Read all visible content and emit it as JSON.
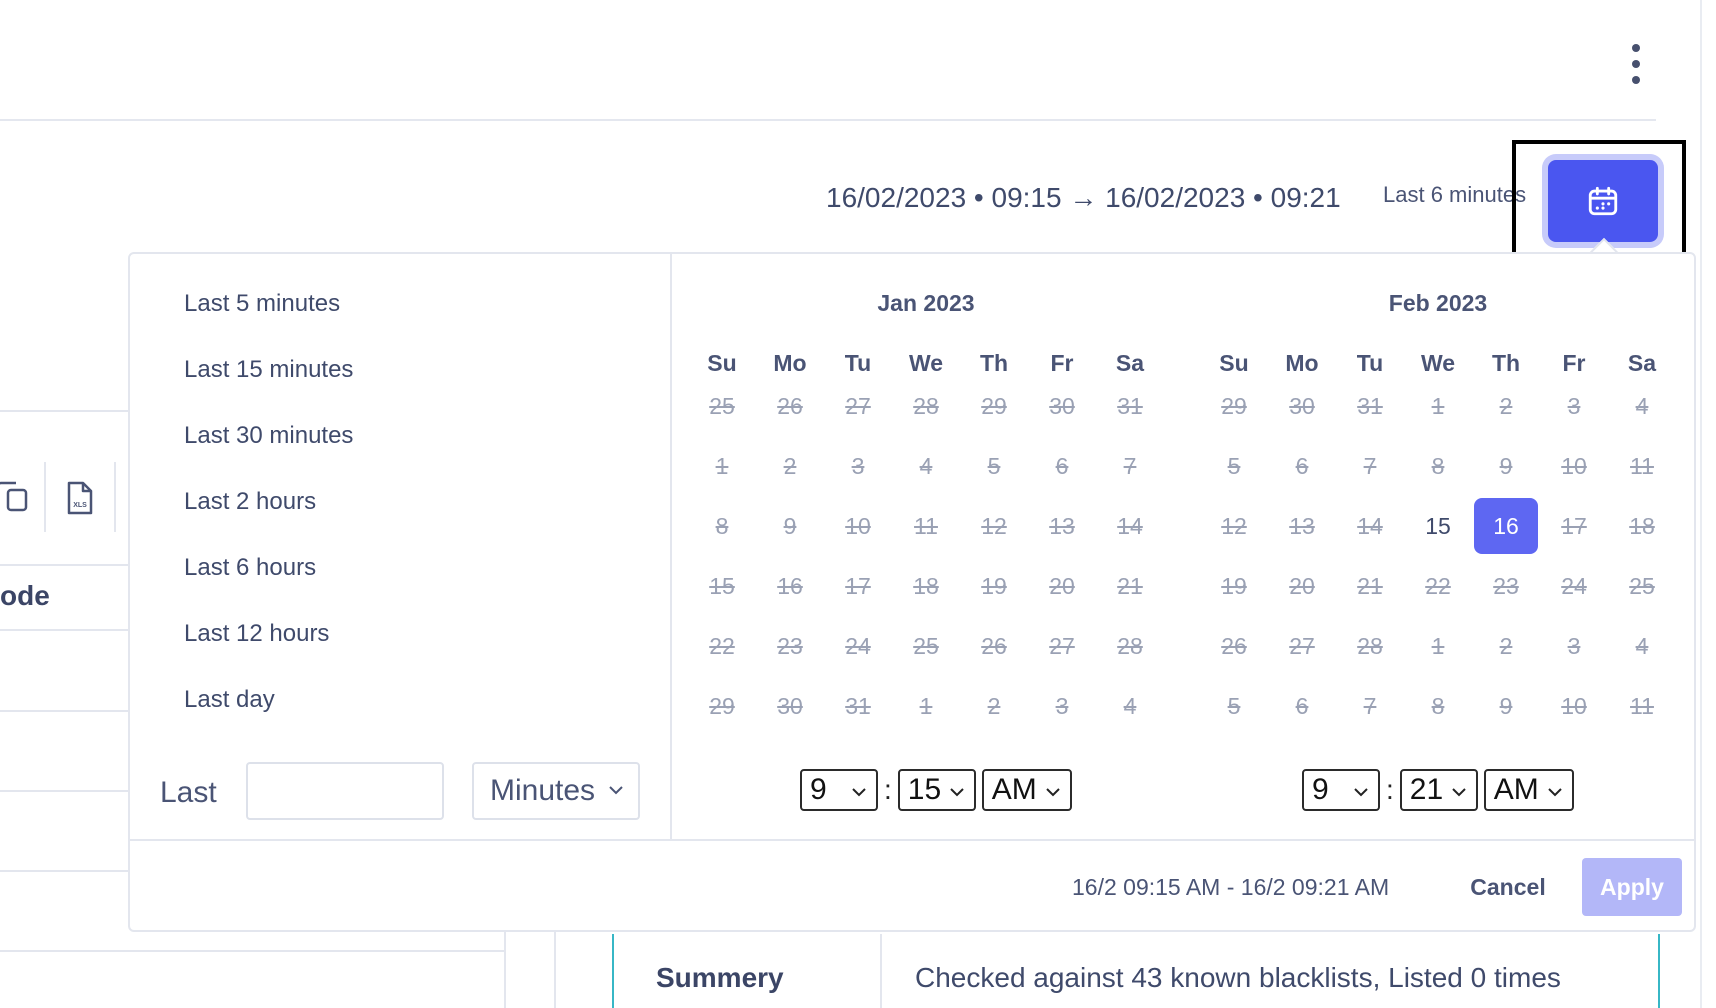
{
  "range": {
    "display": "16/02/2023 • 09:15 → 16/02/2023 • 09:21",
    "label": "Last 6 minutes"
  },
  "background": {
    "column_header": "ode",
    "summary_label": "Summery",
    "summary_value": "Checked against 43 known blacklists, Listed 0 times"
  },
  "presets": [
    "Last 5 minutes",
    "Last 15 minutes",
    "Last 30 minutes",
    "Last 2 hours",
    "Last 6 hours",
    "Last 12 hours",
    "Last day"
  ],
  "custom_last": {
    "label": "Last",
    "value": "",
    "unit": "Minutes"
  },
  "weekdays": [
    "Su",
    "Mo",
    "Tu",
    "We",
    "Th",
    "Fr",
    "Sa"
  ],
  "months": [
    {
      "title": "Jan 2023",
      "days": [
        [
          {
            "d": "25",
            "s": "off"
          },
          {
            "d": "26",
            "s": "off"
          },
          {
            "d": "27",
            "s": "off"
          },
          {
            "d": "28",
            "s": "off"
          },
          {
            "d": "29",
            "s": "off"
          },
          {
            "d": "30",
            "s": "off"
          },
          {
            "d": "31",
            "s": "off"
          }
        ],
        [
          {
            "d": "1",
            "s": "off"
          },
          {
            "d": "2",
            "s": "off"
          },
          {
            "d": "3",
            "s": "off"
          },
          {
            "d": "4",
            "s": "off"
          },
          {
            "d": "5",
            "s": "off"
          },
          {
            "d": "6",
            "s": "off"
          },
          {
            "d": "7",
            "s": "off"
          }
        ],
        [
          {
            "d": "8",
            "s": "off"
          },
          {
            "d": "9",
            "s": "off"
          },
          {
            "d": "10",
            "s": "off"
          },
          {
            "d": "11",
            "s": "off"
          },
          {
            "d": "12",
            "s": "off"
          },
          {
            "d": "13",
            "s": "off"
          },
          {
            "d": "14",
            "s": "off"
          }
        ],
        [
          {
            "d": "15",
            "s": "off"
          },
          {
            "d": "16",
            "s": "off"
          },
          {
            "d": "17",
            "s": "off"
          },
          {
            "d": "18",
            "s": "off"
          },
          {
            "d": "19",
            "s": "off"
          },
          {
            "d": "20",
            "s": "off"
          },
          {
            "d": "21",
            "s": "off"
          }
        ],
        [
          {
            "d": "22",
            "s": "off"
          },
          {
            "d": "23",
            "s": "off"
          },
          {
            "d": "24",
            "s": "off"
          },
          {
            "d": "25",
            "s": "off"
          },
          {
            "d": "26",
            "s": "off"
          },
          {
            "d": "27",
            "s": "off"
          },
          {
            "d": "28",
            "s": "off"
          }
        ],
        [
          {
            "d": "29",
            "s": "off"
          },
          {
            "d": "30",
            "s": "off"
          },
          {
            "d": "31",
            "s": "off"
          },
          {
            "d": "1",
            "s": "off"
          },
          {
            "d": "2",
            "s": "off"
          },
          {
            "d": "3",
            "s": "off"
          },
          {
            "d": "4",
            "s": "off"
          }
        ]
      ],
      "time": {
        "hour": "9",
        "minute": "15",
        "ampm": "AM"
      }
    },
    {
      "title": "Feb 2023",
      "days": [
        [
          {
            "d": "29",
            "s": "off"
          },
          {
            "d": "30",
            "s": "off"
          },
          {
            "d": "31",
            "s": "off"
          },
          {
            "d": "1",
            "s": "off"
          },
          {
            "d": "2",
            "s": "off"
          },
          {
            "d": "3",
            "s": "off"
          },
          {
            "d": "4",
            "s": "off"
          }
        ],
        [
          {
            "d": "5",
            "s": "off"
          },
          {
            "d": "6",
            "s": "off"
          },
          {
            "d": "7",
            "s": "off"
          },
          {
            "d": "8",
            "s": "off"
          },
          {
            "d": "9",
            "s": "off"
          },
          {
            "d": "10",
            "s": "off"
          },
          {
            "d": "11",
            "s": "off"
          }
        ],
        [
          {
            "d": "12",
            "s": "off"
          },
          {
            "d": "13",
            "s": "off"
          },
          {
            "d": "14",
            "s": "off"
          },
          {
            "d": "15",
            "s": "on"
          },
          {
            "d": "16",
            "s": "selected"
          },
          {
            "d": "17",
            "s": "off"
          },
          {
            "d": "18",
            "s": "off"
          }
        ],
        [
          {
            "d": "19",
            "s": "off"
          },
          {
            "d": "20",
            "s": "off"
          },
          {
            "d": "21",
            "s": "off"
          },
          {
            "d": "22",
            "s": "off"
          },
          {
            "d": "23",
            "s": "off"
          },
          {
            "d": "24",
            "s": "off"
          },
          {
            "d": "25",
            "s": "off"
          }
        ],
        [
          {
            "d": "26",
            "s": "off"
          },
          {
            "d": "27",
            "s": "off"
          },
          {
            "d": "28",
            "s": "off"
          },
          {
            "d": "1",
            "s": "off"
          },
          {
            "d": "2",
            "s": "off"
          },
          {
            "d": "3",
            "s": "off"
          },
          {
            "d": "4",
            "s": "off"
          }
        ],
        [
          {
            "d": "5",
            "s": "off"
          },
          {
            "d": "6",
            "s": "off"
          },
          {
            "d": "7",
            "s": "off"
          },
          {
            "d": "8",
            "s": "off"
          },
          {
            "d": "9",
            "s": "off"
          },
          {
            "d": "10",
            "s": "off"
          },
          {
            "d": "11",
            "s": "off"
          }
        ]
      ],
      "time": {
        "hour": "9",
        "minute": "21",
        "ampm": "AM"
      }
    }
  ],
  "footer": {
    "range": "16/2 09:15 AM - 16/2 09:21 AM",
    "cancel": "Cancel",
    "apply": "Apply"
  },
  "colors": {
    "accent": "#4a56f0",
    "selected_day": "#5e67f2",
    "apply_disabled": "#b3b7f8"
  },
  "icons": {
    "more": "kebab-menu-icon",
    "calendar": "calendar-icon",
    "copy": "copy-icon",
    "xls": "xls-file-icon",
    "chevron": "chevron-down-icon"
  }
}
